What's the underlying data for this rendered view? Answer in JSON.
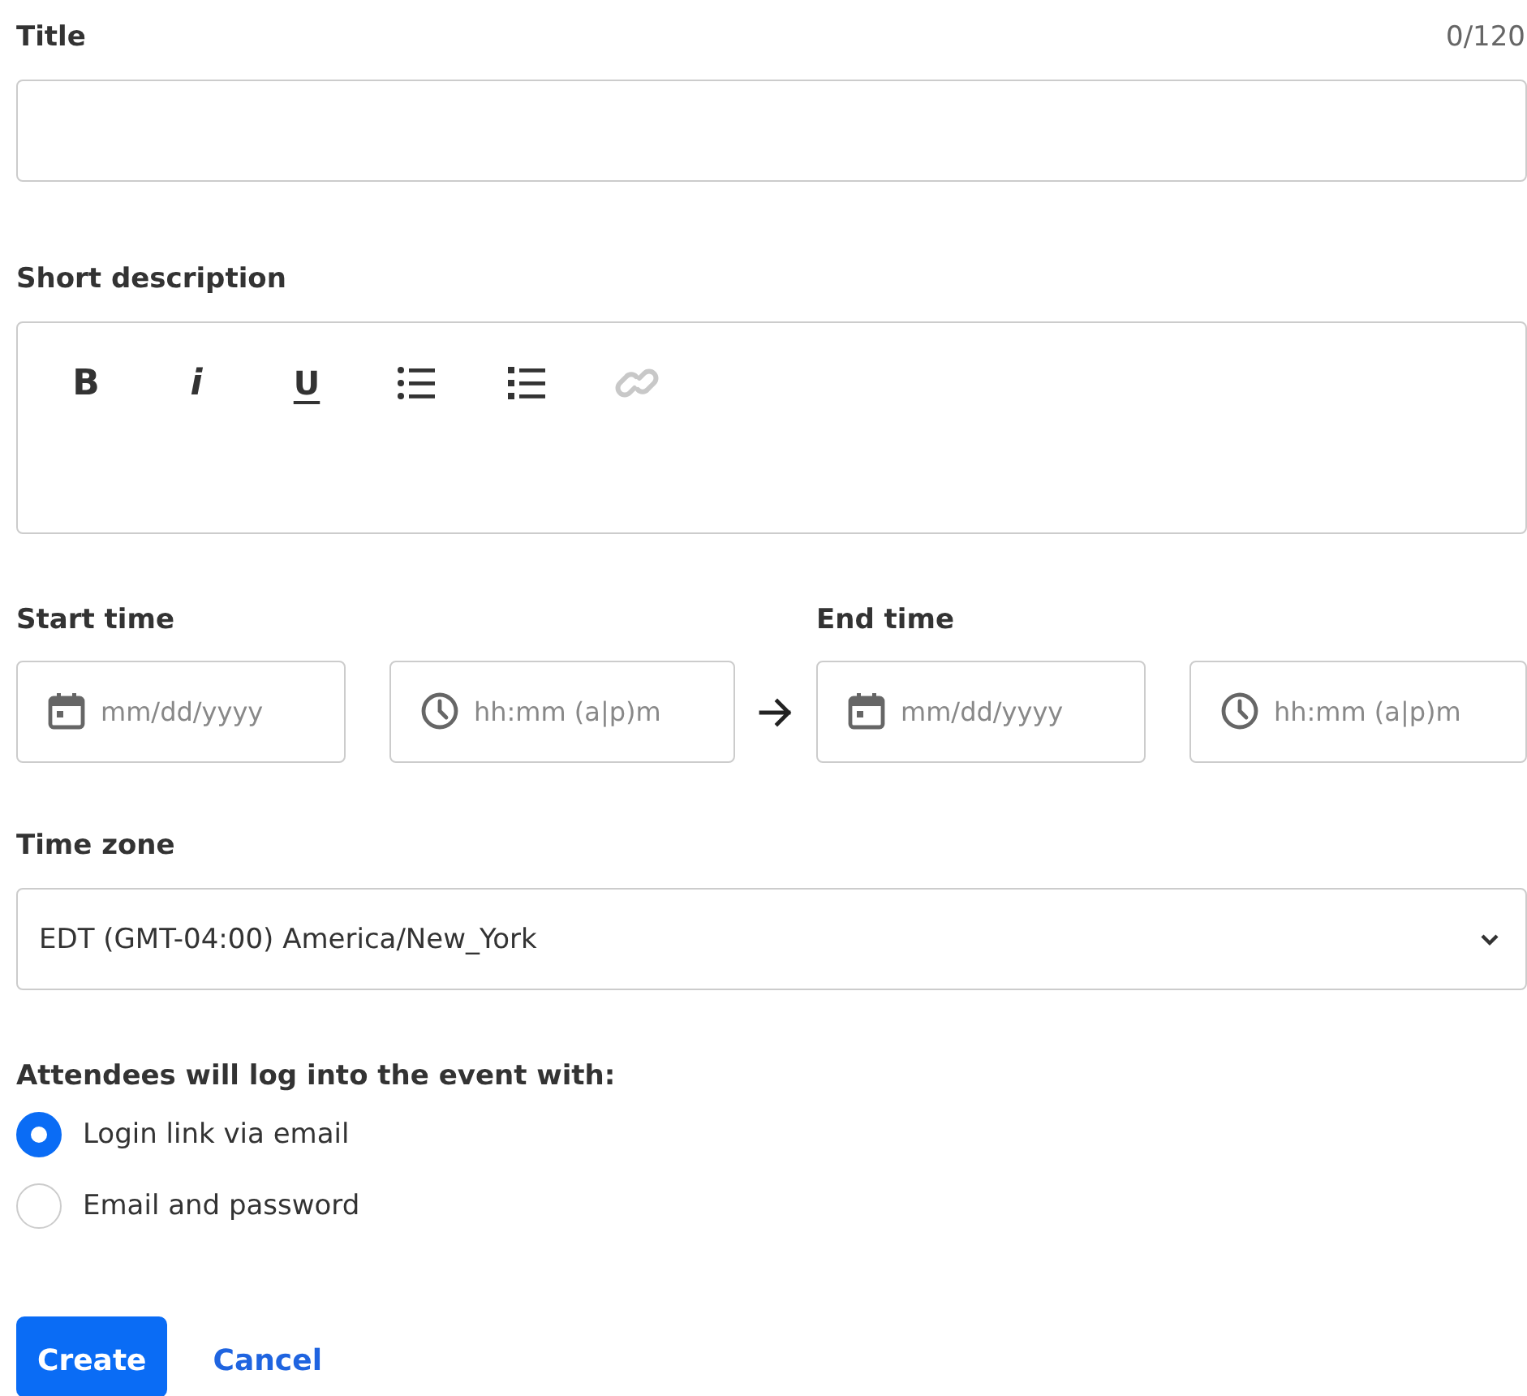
{
  "title_field": {
    "label": "Title",
    "counter": "0/120"
  },
  "description": {
    "label": "Short description",
    "toolbar": [
      {
        "kind": "bold",
        "text": "B",
        "disabled": false
      },
      {
        "kind": "italic",
        "text": "i",
        "disabled": false
      },
      {
        "kind": "underline",
        "text": "U",
        "disabled": false
      },
      {
        "kind": "bullets",
        "disabled": false
      },
      {
        "kind": "numbers",
        "disabled": false
      },
      {
        "kind": "link",
        "disabled": true
      }
    ]
  },
  "start_time": {
    "label": "Start time",
    "date_placeholder": "mm/dd/yyyy",
    "time_placeholder": "hh:mm (a|p)m"
  },
  "end_time": {
    "label": "End time",
    "date_placeholder": "mm/dd/yyyy",
    "time_placeholder": "hh:mm (a|p)m"
  },
  "time_zone": {
    "label": "Time zone",
    "value": "EDT (GMT-04:00) America/New_York"
  },
  "login": {
    "label": "Attendees will log into the event with:",
    "options": [
      {
        "label": "Login link via email",
        "selected": true
      },
      {
        "label": "Email and password",
        "selected": false
      }
    ]
  },
  "buttons": [
    {
      "kind": "primary",
      "label": "Create"
    },
    {
      "kind": "link",
      "label": "Cancel"
    }
  ]
}
